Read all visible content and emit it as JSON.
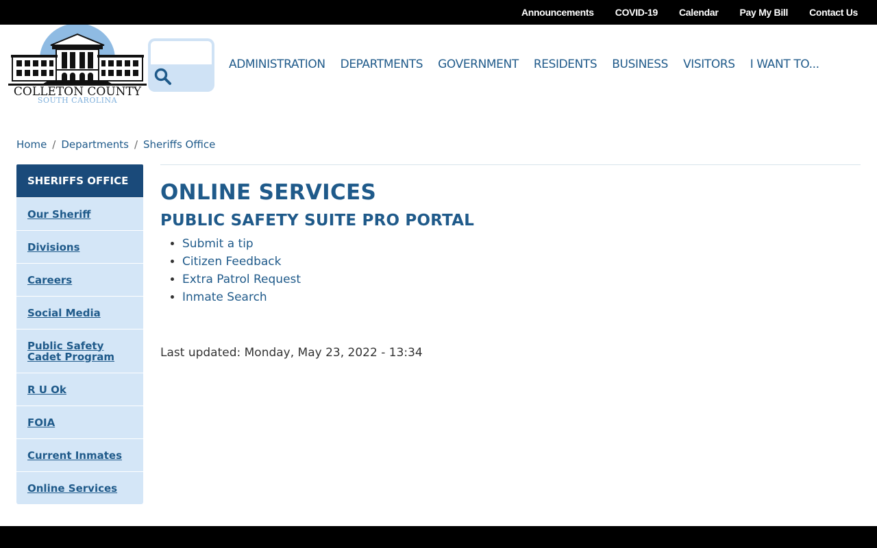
{
  "utility_nav": [
    "Announcements",
    "COVID-19",
    "Calendar",
    "Pay My Bill",
    "Contact Us"
  ],
  "logo": {
    "name": "COLLETON COUNTY",
    "subtitle": "SOUTH CAROLINA"
  },
  "search": {
    "placeholder": ""
  },
  "main_nav": [
    "ADMINISTRATION",
    "DEPARTMENTS",
    "GOVERNMENT",
    "RESIDENTS",
    "BUSINESS",
    "VISITORS",
    "I WANT TO..."
  ],
  "breadcrumb": [
    "Home",
    "Departments",
    "Sheriffs Office"
  ],
  "sidebar": {
    "header": "SHERIFFS OFFICE",
    "items": [
      "Our Sheriff",
      "Divisions",
      "Careers",
      "Social Media",
      "Public Safety Cadet Program",
      "R U Ok",
      "FOIA",
      "Current Inmates",
      "Online Services"
    ]
  },
  "content": {
    "title": "ONLINE SERVICES",
    "section_title": "PUBLIC SAFETY SUITE PRO PORTAL",
    "links": [
      "Submit a tip",
      "Citizen Feedback",
      "Extra Patrol Request",
      "Inmate Search"
    ],
    "last_updated": "Last updated: Monday, May 23, 2022 - 13:34"
  },
  "colors": {
    "brand_blue": "#1f5a8a",
    "sidebar_header": "#1a4a7a",
    "sidebar_item_bg": "#d4e6f7",
    "search_bg": "#cfe2f5",
    "top_bar": "#000000"
  },
  "icons": {
    "search": "search-icon",
    "logo": "courthouse-logo-icon"
  }
}
